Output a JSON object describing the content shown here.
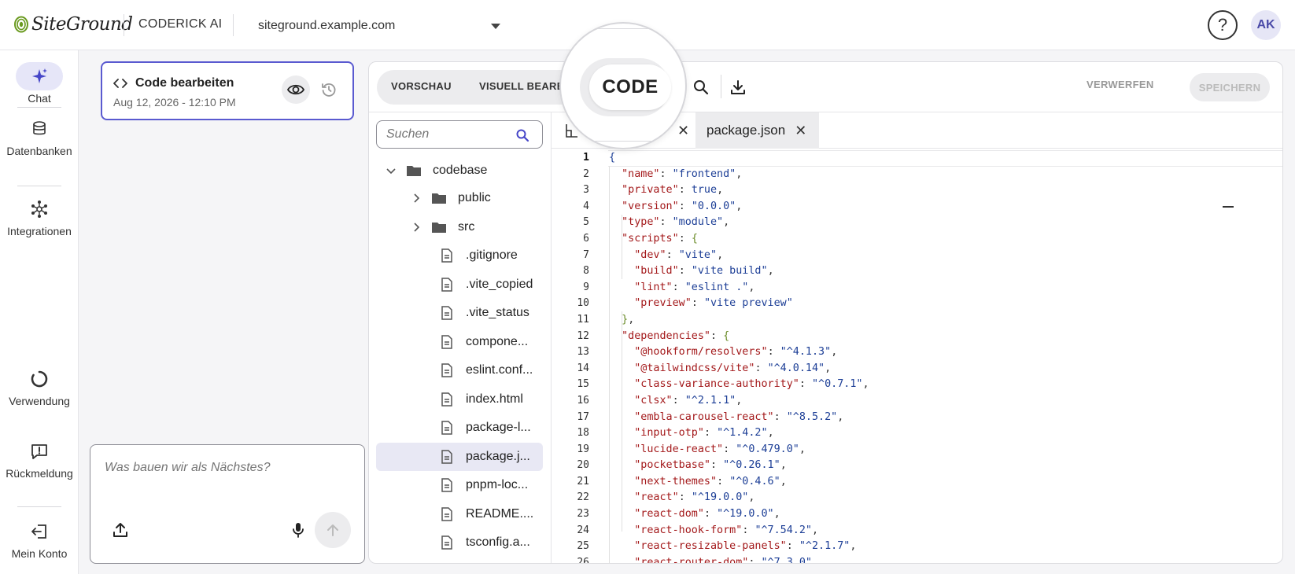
{
  "header": {
    "logo_text": "SiteGround",
    "product_name": "CODERICK AI",
    "site_select": "siteground.example.com",
    "help_label": "?",
    "avatar_initials": "AK"
  },
  "nav": {
    "chat": "Chat",
    "databases": "Datenbanken",
    "integrations": "Integrationen",
    "usage": "Verwendung",
    "feedback": "Rückmeldung",
    "account": "Mein Konto"
  },
  "session": {
    "title": "Code bearbeiten",
    "date": "Aug 12, 2026 - 12:10 PM"
  },
  "composer": {
    "placeholder": "Was bauen wir als Nächstes?"
  },
  "toolbar": {
    "tab_preview": "VORSCHAU",
    "tab_visual": "VISUELL BEARBEITEN",
    "tab_code": "CODE",
    "discard": "VERWERFEN",
    "save": "SPEICHERN"
  },
  "filetree": {
    "search_placeholder": "Suchen",
    "items": [
      {
        "name": "codebase",
        "kind": "folder"
      },
      {
        "name": "public",
        "kind": "folder"
      },
      {
        "name": "src",
        "kind": "folder"
      },
      {
        "name": ".gitignore",
        "kind": "file"
      },
      {
        "name": ".vite_copied",
        "kind": "file"
      },
      {
        "name": ".vite_status",
        "kind": "file"
      },
      {
        "name": "compone...",
        "kind": "file"
      },
      {
        "name": "eslint.conf...",
        "kind": "file"
      },
      {
        "name": "index.html",
        "kind": "file"
      },
      {
        "name": "package-l...",
        "kind": "file"
      },
      {
        "name": "package.j...",
        "kind": "file",
        "selected": true
      },
      {
        "name": "pnpm-loc...",
        "kind": "file"
      },
      {
        "name": "README....",
        "kind": "file"
      },
      {
        "name": "tsconfig.a...",
        "kind": "file"
      }
    ]
  },
  "editor_tabs": {
    "active": "package.json",
    "close_glyph": "✕"
  },
  "code": {
    "lines": [
      "{",
      "  \"name\": \"frontend\",",
      "  \"private\": true,",
      "  \"version\": \"0.0.0\",",
      "  \"type\": \"module\",",
      "  \"scripts\": {",
      "    \"dev\": \"vite\",",
      "    \"build\": \"vite build\",",
      "    \"lint\": \"eslint .\",",
      "    \"preview\": \"vite preview\"",
      "  },",
      "  \"dependencies\": {",
      "    \"@hookform/resolvers\": \"^4.1.3\",",
      "    \"@tailwindcss/vite\": \"^4.0.14\",",
      "    \"class-variance-authority\": \"^0.7.1\",",
      "    \"clsx\": \"^2.1.1\",",
      "    \"embla-carousel-react\": \"^8.5.2\",",
      "    \"input-otp\": \"^1.4.2\",",
      "    \"lucide-react\": \"^0.479.0\",",
      "    \"pocketbase\": \"^0.26.1\",",
      "    \"next-themes\": \"^0.4.6\",",
      "    \"react\": \"^19.0.0\",",
      "    \"react-dom\": \"^19.0.0\",",
      "    \"react-hook-form\": \"^7.54.2\",",
      "    \"react-resizable-panels\": \"^2.1.7\",",
      "    \"react-router-dom\": \"^7.3.0\","
    ]
  },
  "colors": {
    "accent": "#5a5ad0",
    "json_key": "#a3181a",
    "json_value": "#1c3e96",
    "selected_row": "#e8e8f4"
  }
}
